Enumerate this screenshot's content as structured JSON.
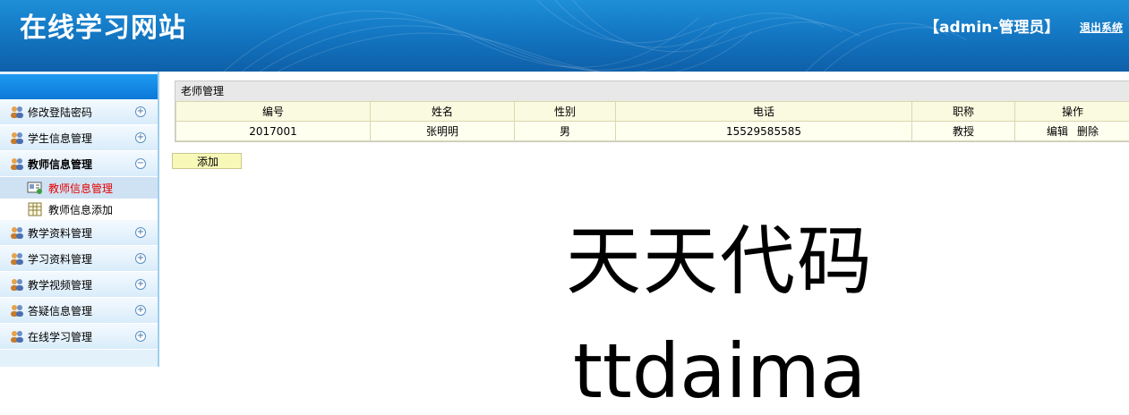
{
  "header": {
    "site_title": "在线学习网站",
    "user_info": "【admin-管理员】",
    "logout": "退出系统"
  },
  "sidebar": {
    "items": [
      {
        "label": "修改登陆密码",
        "toggle": "+"
      },
      {
        "label": "学生信息管理",
        "toggle": "+"
      },
      {
        "label": "教师信息管理",
        "toggle": "−",
        "expanded": true,
        "sub": [
          {
            "label": "教师信息管理",
            "selected": true
          },
          {
            "label": "教师信息添加",
            "selected": false
          }
        ]
      },
      {
        "label": "教学资料管理",
        "toggle": "+"
      },
      {
        "label": "学习资料管理",
        "toggle": "+"
      },
      {
        "label": "教学视频管理",
        "toggle": "+"
      },
      {
        "label": "答疑信息管理",
        "toggle": "+"
      },
      {
        "label": "在线学习管理",
        "toggle": "+"
      }
    ]
  },
  "main": {
    "panel_title": "老师管理",
    "columns": [
      "编号",
      "姓名",
      "性别",
      "电话",
      "职称",
      "操作"
    ],
    "rows": [
      {
        "id": "2017001",
        "name": "张明明",
        "gender": "男",
        "phone": "15529585585",
        "title": "教授",
        "edit": "编辑",
        "delete": "删除"
      }
    ],
    "add_button": "添加"
  },
  "watermark": {
    "line1": "天天代码",
    "line2": "ttdaima"
  },
  "colors": {
    "header_blue": "#1478c4",
    "selected_text": "#e60000",
    "table_bg": "#fffff0",
    "button_bg": "#f8f8b8"
  }
}
